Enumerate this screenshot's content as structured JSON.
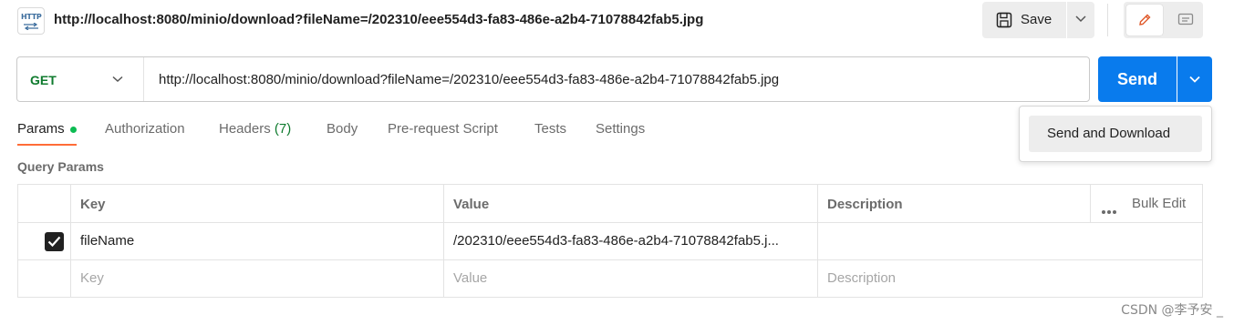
{
  "header": {
    "badge_icon": "http-request-icon",
    "badge_text": "HTTP",
    "title": "http://localhost:8080/minio/download?fileName=/202310/eee554d3-fa83-486e-a2b4-71078842fab5.jpg",
    "save_label": "Save",
    "save_icon": "save-icon",
    "caret_icon": "chevron-down-icon",
    "edit_icon": "pencil-icon",
    "comment_icon": "comment-icon"
  },
  "request": {
    "method": "GET",
    "url": "http://localhost:8080/minio/download?fileName=/202310/eee554d3-fa83-486e-a2b4-71078842fab5.jpg",
    "send_label": "Send"
  },
  "tabs": [
    {
      "label": "Params",
      "active": true
    },
    {
      "label": "Authorization"
    },
    {
      "label": "Headers",
      "count": "(7)"
    },
    {
      "label": "Body"
    },
    {
      "label": "Pre-request Script"
    },
    {
      "label": "Tests"
    },
    {
      "label": "Settings"
    }
  ],
  "params": {
    "section_title": "Query Params",
    "headers": {
      "key": "Key",
      "value": "Value",
      "description": "Description",
      "bulk_edit": "Bulk Edit"
    },
    "rows": [
      {
        "checked": true,
        "key": "fileName",
        "value": "/202310/eee554d3-fa83-486e-a2b4-71078842fab5.j...",
        "description": ""
      }
    ],
    "placeholder": {
      "key": "Key",
      "value": "Value",
      "description": "Description"
    }
  },
  "dropdown": {
    "item": "Send and Download"
  },
  "watermark": "CSDN @李予安 _",
  "colors": {
    "accent_send": "#097bed",
    "method_get": "#0f7b2e",
    "tab_underline": "#ff6c37",
    "dot": "#0cbb52"
  }
}
